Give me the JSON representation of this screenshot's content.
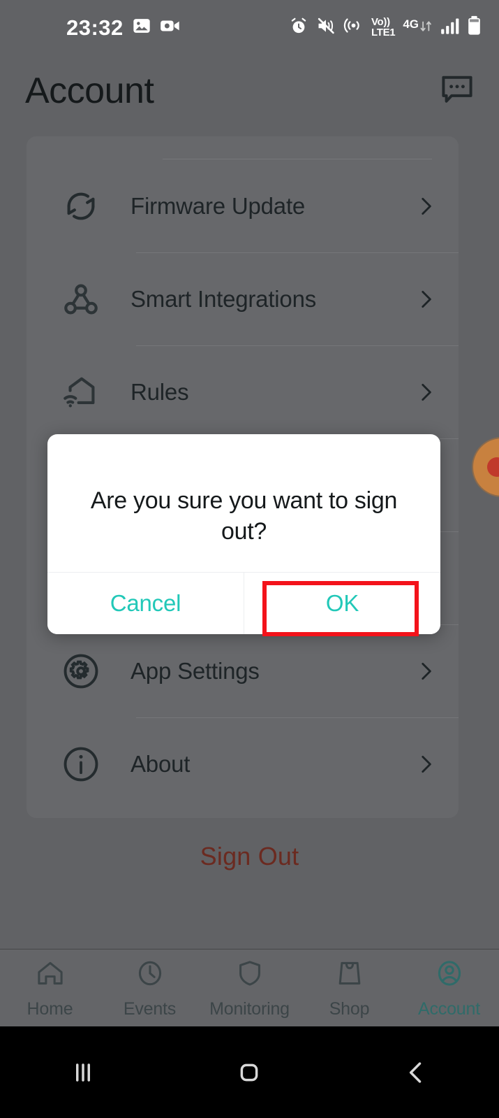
{
  "status_bar": {
    "time": "23:32",
    "left_icons": [
      "image-icon",
      "video-camera-icon"
    ],
    "right_icons": [
      "alarm-icon",
      "mute-vibrate-icon",
      "hotspot-icon"
    ],
    "volte_line1": "Vo))",
    "volte_line2": "LTE1",
    "network": "4G",
    "data_arrows": "down-up-arrows-icon",
    "signal": "signal-bars-icon",
    "battery": "battery-icon"
  },
  "header": {
    "title": "Account",
    "chat_icon": "chat-bubble-icon"
  },
  "settings_list": {
    "rows": [
      {
        "label": "Firmware Update",
        "icon": "sync-refresh-icon"
      },
      {
        "label": "Smart Integrations",
        "icon": "node-graph-icon"
      },
      {
        "label": "Rules",
        "icon": "home-wifi-icon"
      },
      {
        "label": "App Settings",
        "icon": "gear-icon"
      },
      {
        "label": "About",
        "icon": "info-circle-icon"
      }
    ]
  },
  "sign_out": {
    "label": "Sign Out",
    "color": "#6b2a20"
  },
  "floating_action": {
    "icon": "avatar-circle-icon",
    "color": "#c8813f",
    "dot_color": "#c0392b"
  },
  "dialog": {
    "message": "Are you sure you want to sign out?",
    "cancel_label": "Cancel",
    "ok_label": "OK",
    "action_color": "#22c8b8",
    "highlight_color": "#f3131b",
    "highlighted_action": "OK"
  },
  "bottom_nav": {
    "items": [
      {
        "label": "Home",
        "icon": "home-icon",
        "active": false
      },
      {
        "label": "Events",
        "icon": "clock-icon",
        "active": false
      },
      {
        "label": "Monitoring",
        "icon": "shield-icon",
        "active": false
      },
      {
        "label": "Shop",
        "icon": "shopping-bag-icon",
        "active": false
      },
      {
        "label": "Account",
        "icon": "account-person-icon",
        "active": true
      }
    ],
    "active_color": "#2f6b69",
    "inactive_color": "#3c4548"
  },
  "system_nav": {
    "recents": "recents-bars-icon",
    "home": "home-square-icon",
    "back": "back-chevron-icon"
  }
}
